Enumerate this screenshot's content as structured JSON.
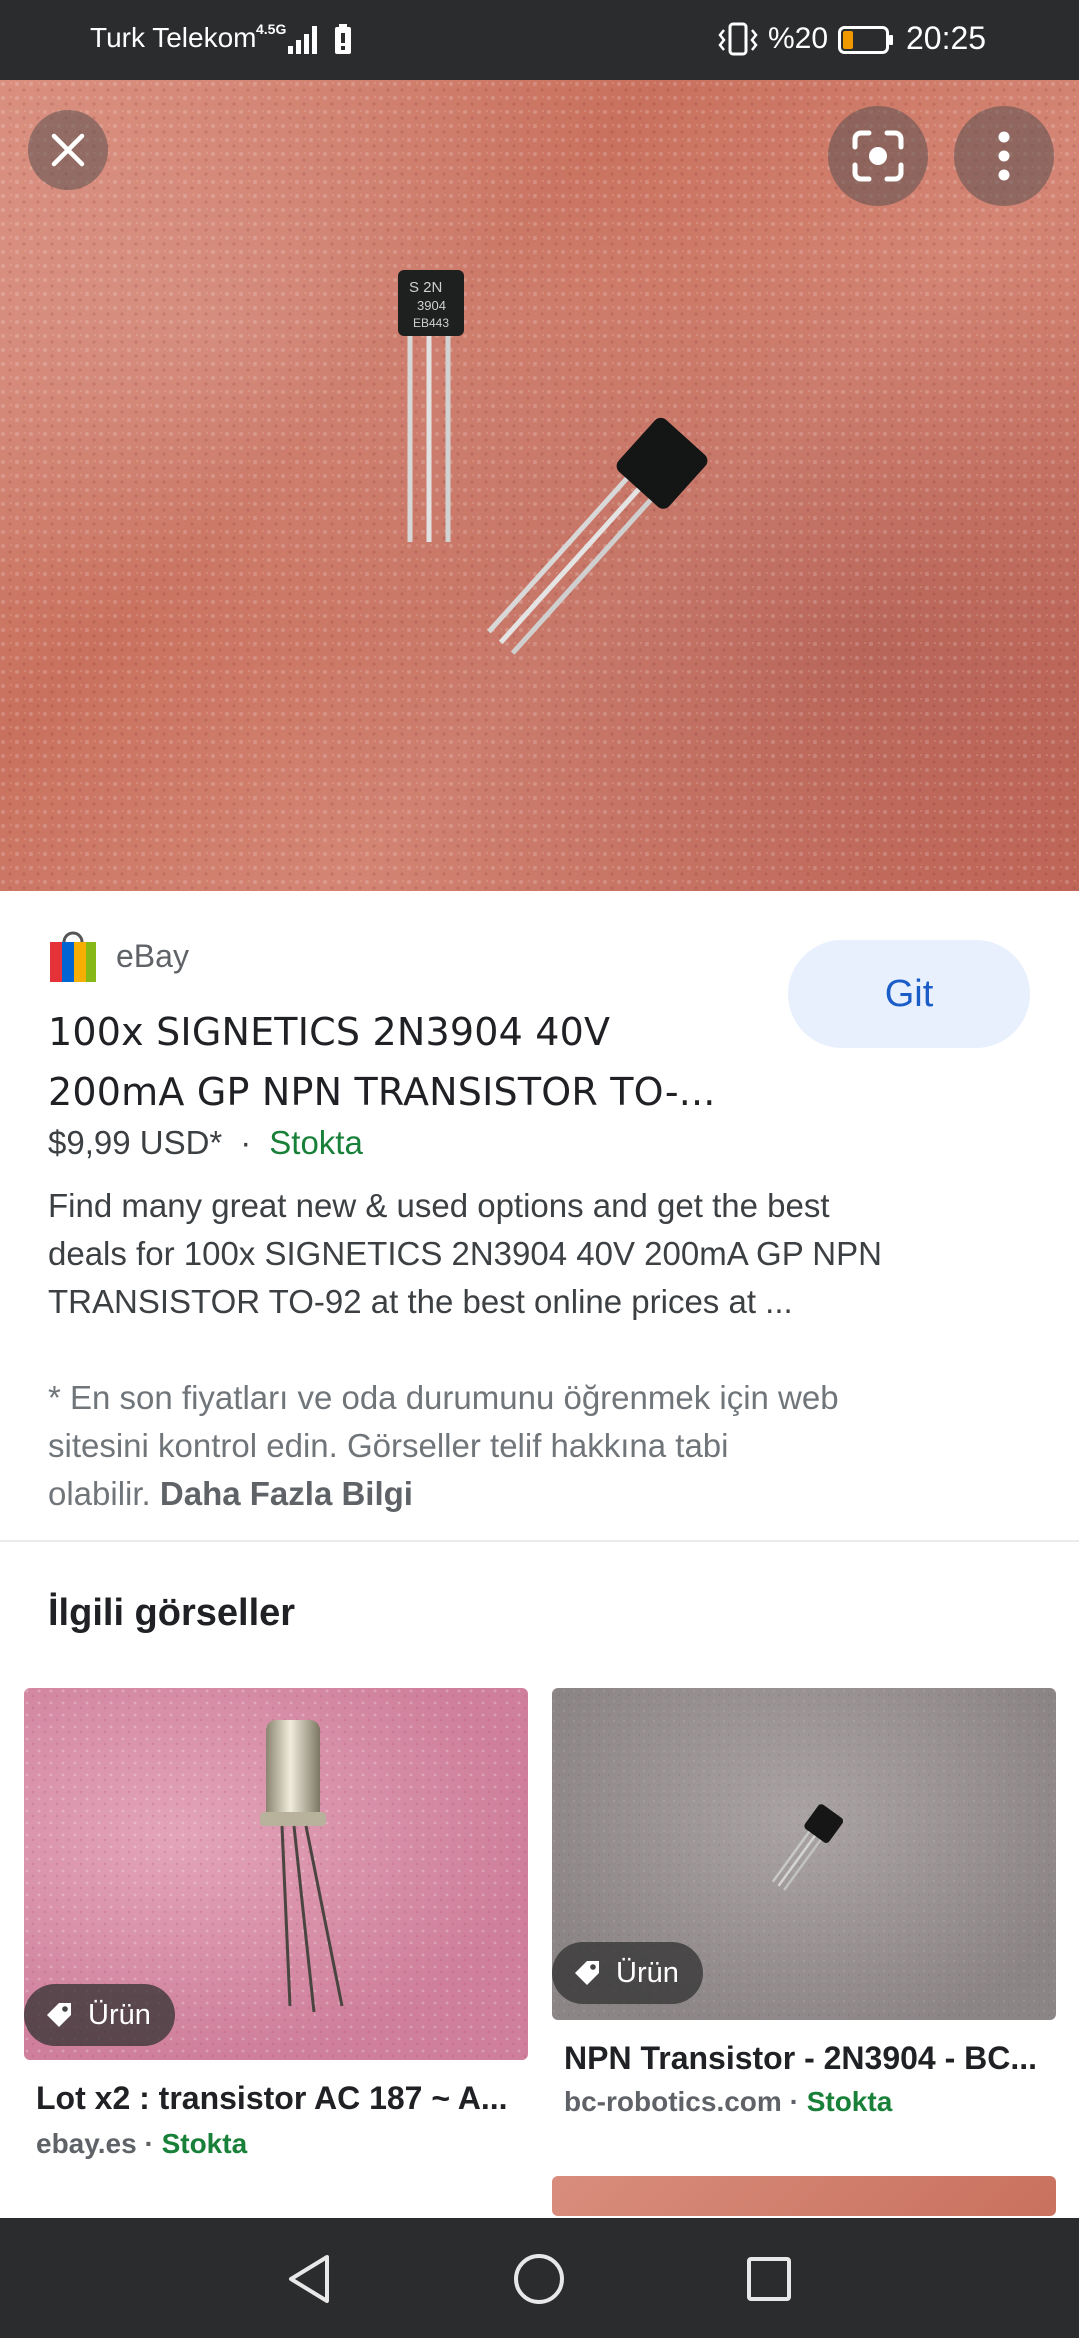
{
  "status_bar": {
    "carrier": "Turk Telekom",
    "network": "4.5G",
    "battery_percent": "%20",
    "time": "20:25",
    "icons": [
      "signal-icon",
      "battery-saver-icon",
      "vibrate-icon",
      "battery-icon"
    ]
  },
  "viewer": {
    "close_icon": "close-icon",
    "lens_icon": "lens-icon",
    "more_icon": "more-vert-icon"
  },
  "result": {
    "source": "eBay",
    "open_label": "Git",
    "title_line1": "100x SIGNETICS 2N3904 40V",
    "title_line2": "200mA GP NPN TRANSISTOR TO-...",
    "price": "$9,99 USD*",
    "separator": "·",
    "stock": "Stokta",
    "description_line1": "Find many great new & used options and get the best",
    "description_line2": "deals for 100x SIGNETICS 2N3904 40V 200mA GP NPN",
    "description_line3": "TRANSISTOR TO-92 at the best online prices at ...",
    "disclaimer_line1": "* En son fiyatları ve oda durumunu öğrenmek için web",
    "disclaimer_line2": "sitesini kontrol edin. Görseller telif hakkına tabi",
    "disclaimer_line3": "olabilir.",
    "more_info": "Daha Fazla Bilgi",
    "image_chip_text": "S 2N 3904 EB443"
  },
  "related": {
    "heading": "İlgili görseller",
    "items": [
      {
        "badge": "Ürün",
        "title": "Lot x2 : transistor AC 187 ~ A...",
        "site": "ebay.es",
        "separator": " · ",
        "stock": "Stokta"
      },
      {
        "badge": "Ürün",
        "title": "NPN Transistor - 2N3904 - BC...",
        "site": "bc-robotics.com",
        "separator": " · ",
        "stock": "Stokta"
      }
    ]
  },
  "nav_bar": {
    "icons": [
      "back-icon",
      "home-icon",
      "recents-icon"
    ]
  },
  "colors": {
    "accent_blue": "#1a5cc8",
    "button_bg": "#e8f0fe",
    "stock_green": "#188038",
    "system_bar": "#2b2c2e"
  }
}
